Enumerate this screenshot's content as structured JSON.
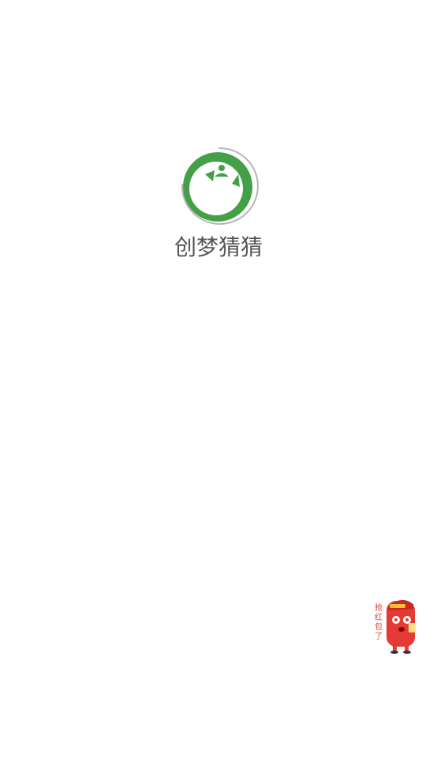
{
  "app": {
    "name": "创梦猜猜"
  },
  "logo": {
    "icon": "app-logo-icon",
    "color": "#43A047"
  },
  "floating_button": {
    "icon": "red-envelope-mascot-icon",
    "text": "抢红包了",
    "color": "#E53935"
  }
}
